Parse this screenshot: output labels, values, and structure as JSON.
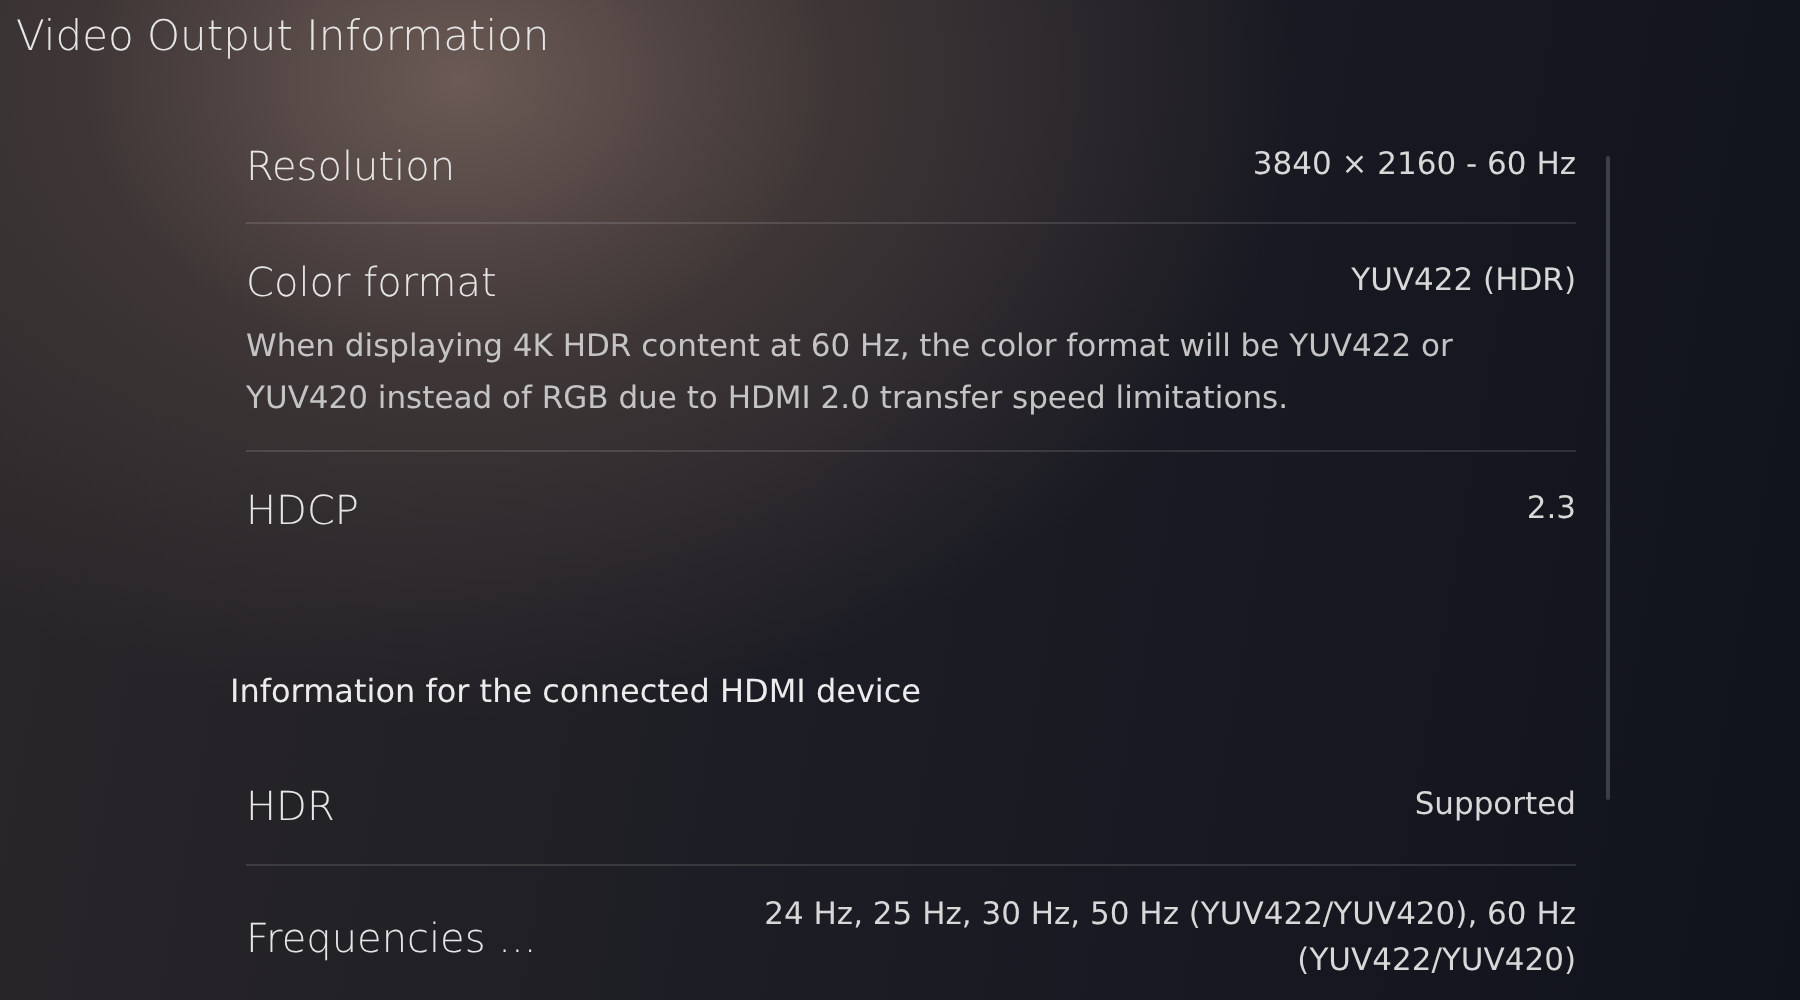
{
  "title": "Video Output Information",
  "rows": [
    {
      "label": "Resolution",
      "value": "3840 × 2160 - 60 Hz"
    },
    {
      "label": "Color format",
      "value": "YUV422 (HDR)",
      "description": "When displaying 4K HDR content at 60 Hz, the color format will be YUV422 or YUV420 instead of RGB due to HDMI 2.0 transfer speed limitations."
    },
    {
      "label": "HDCP",
      "value": "2.3"
    }
  ],
  "hdmi_section": {
    "heading": "Information for the connected HDMI device",
    "rows": [
      {
        "label": "HDR",
        "value": "Supported"
      },
      {
        "label": "Frequencies ...",
        "value": "24 Hz, 25 Hz, 30 Hz, 50 Hz (YUV422/YUV420), 60 Hz (YUV422/YUV420)"
      }
    ]
  }
}
